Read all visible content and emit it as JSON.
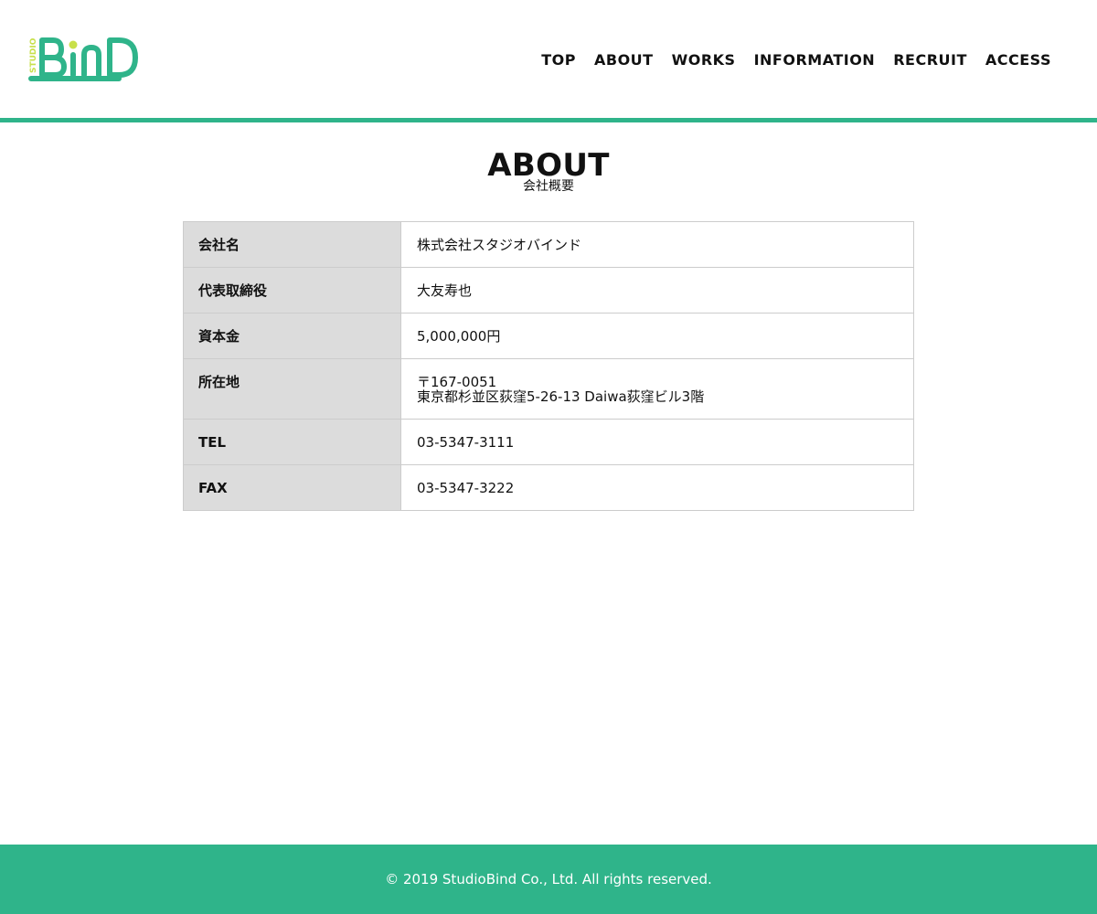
{
  "brand": {
    "logo_text": "BiND",
    "logo_subtext": "STUDIO",
    "primary_color": "#2fb48a",
    "accent_color": "#c8e04a"
  },
  "nav": {
    "items": [
      {
        "label": "TOP"
      },
      {
        "label": "ABOUT"
      },
      {
        "label": "WORKS"
      },
      {
        "label": "INFORMATION"
      },
      {
        "label": "RECRUIT"
      },
      {
        "label": "ACCESS"
      }
    ]
  },
  "page": {
    "title": "ABOUT",
    "subtitle": "会社概要"
  },
  "company_table": {
    "rows": [
      {
        "label": "会社名",
        "lines": [
          "株式会社スタジオバインド"
        ]
      },
      {
        "label": "代表取締役",
        "lines": [
          "大友寿也"
        ]
      },
      {
        "label": "資本金",
        "lines": [
          "5,000,000円"
        ]
      },
      {
        "label": "所在地",
        "lines": [
          "〒167-0051",
          "東京都杉並区荻窪5-26-13 Daiwa荻窪ビル3階"
        ]
      },
      {
        "label": "TEL",
        "lines": [
          "03-5347-3111"
        ]
      },
      {
        "label": "FAX",
        "lines": [
          "03-5347-3222"
        ]
      }
    ]
  },
  "footer": {
    "copyright": "© 2019 StudioBind Co., Ltd. All rights reserved."
  }
}
